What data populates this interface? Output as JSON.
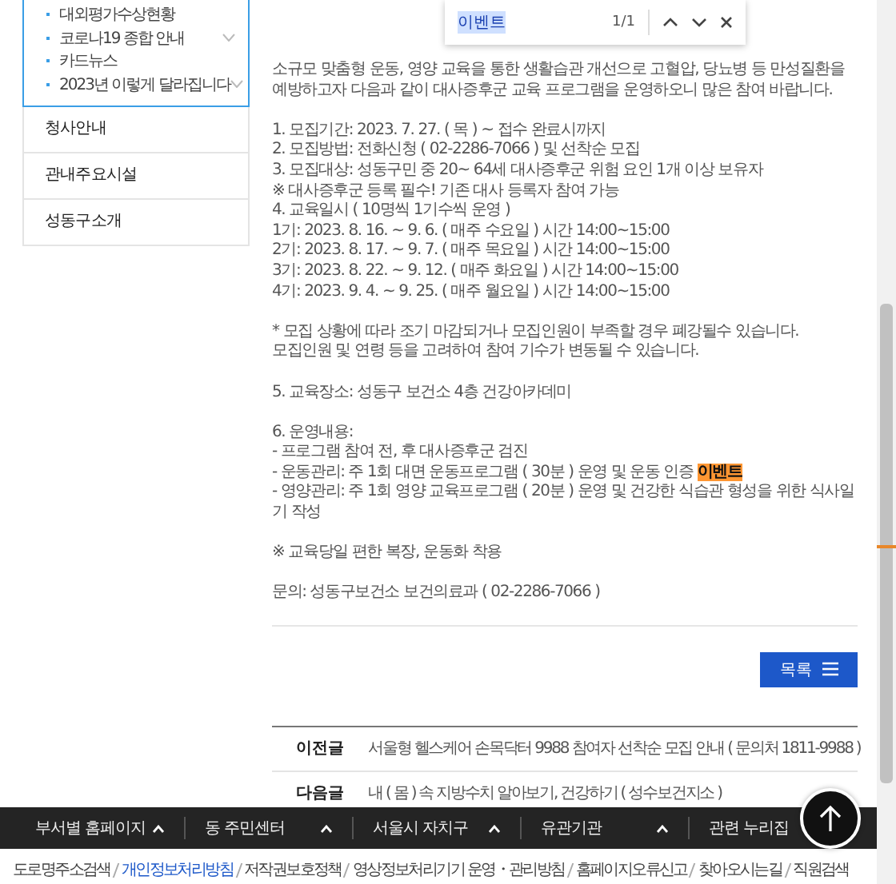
{
  "sidebar": {
    "submenu": [
      {
        "label": "대외평가수상현황",
        "has_children": false
      },
      {
        "label": "코로나19 종합 안내",
        "has_children": true
      },
      {
        "label": "카드뉴스",
        "has_children": false
      },
      {
        "label": "2023년 이렇게 달라집니다",
        "has_children": true
      }
    ],
    "items": [
      "청사안내",
      "관내주요시설",
      "성동구소개"
    ]
  },
  "find_bar": {
    "query": "이벤트",
    "count": "1/1"
  },
  "article": {
    "paragraphs": [
      [
        {
          "text": "소규모 맞춤형 운동, 영양 교육을 통한 생활습관 개선으로 고혈압, 당뇨병 등 만성질환을 예방하고자 다음과 같이 대사증후군 교육 프로그램을 운영하오니 많은 참여 바랍니다."
        }
      ],
      [
        {
          "text": "1. 모집기간: 2023. 7. 27. ( 목 ) ~ 접수 완료시까지"
        },
        {
          "text": "2. 모집방법: 전화신청 ( 02-2286-7066 ) 및 선착순 모집"
        },
        {
          "text": "3. 모집대상: 성동구민 중 20~ 64세 대사증후군 위험 요인 1개 이상 보유자"
        },
        {
          "text": "※ 대사증후군 등록 필수! 기존 대사 등록자 참여 가능"
        },
        {
          "text": "4. 교육일시 ( 10명씩 1기수씩 운영 )"
        },
        {
          "text": "1기: 2023. 8. 16. ~ 9. 6. ( 매주 수요일 ) 시간 14:00~15:00"
        },
        {
          "text": "2기: 2023. 8. 17. ~ 9. 7. ( 매주 목요일 ) 시간 14:00~15:00"
        },
        {
          "text": "3기: 2023. 8. 22. ~ 9. 12. ( 매주 화요일 ) 시간 14:00~15:00"
        },
        {
          "text": "4기: 2023. 9. 4. ~ 9. 25. ( 매주 월요일 ) 시간 14:00~15:00"
        }
      ],
      [
        {
          "text": "* 모집 상황에 따라 조기 마감되거나 모집인원이 부족할 경우 폐강될수 있습니다."
        },
        {
          "text": "모집인원 및 연령 등을 고려하여 참여 기수가 변동될 수 있습니다."
        }
      ],
      [
        {
          "text": "5. 교육장소: 성동구 보건소 4층 건강아카데미"
        }
      ],
      [
        {
          "text": "6. 운영내용:"
        },
        {
          "text": "- 프로그램 참여 전, 후 대사증후군 검진"
        },
        {
          "text": "- 운동관리: 주 1회 대면 운동프로그램 ( 30분 ) 운영 및 운동 인증 ",
          "highlight": "이벤트"
        },
        {
          "text": "- 영양관리: 주 1회 영양 교육프로그램 ( 20분 ) 운영 및 건강한 식습관 형성을 위한 식사일기 작성"
        }
      ],
      [
        {
          "text": "※ 교육당일 편한 복장, 운동화 착용"
        }
      ],
      [
        {
          "text": "문의: 성동구보건소 보건의료과 ( 02-2286-7066 )"
        }
      ]
    ]
  },
  "list_button": "목록",
  "navigation": [
    {
      "label": "이전글",
      "title": "서울형 헬스케어 손목닥터 9988 참여자 선착순 모집 안내 ( 문의처 1811-9988 )"
    },
    {
      "label": "다음글",
      "title": "내 ( 몸 ) 속 지방수치 알아보기, 건강하기 ( 성수보건지소 )"
    }
  ],
  "footer_menu": [
    "부서별 홈페이지",
    "동 주민센터",
    "서울시 자치구",
    "유관기관",
    "관련 누리집"
  ],
  "footer_links": [
    {
      "label": "도로명주소검색",
      "highlighted": false
    },
    {
      "label": "개인정보처리방침",
      "highlighted": true
    },
    {
      "label": "저작권보호정책",
      "highlighted": false
    },
    {
      "label": "영상정보처리기기 운영・관리방침",
      "highlighted": false
    },
    {
      "label": "홈페이지오류신고",
      "highlighted": false
    },
    {
      "label": "찾아오시는길",
      "highlighted": false
    },
    {
      "label": "직원검색",
      "highlighted": false
    }
  ]
}
